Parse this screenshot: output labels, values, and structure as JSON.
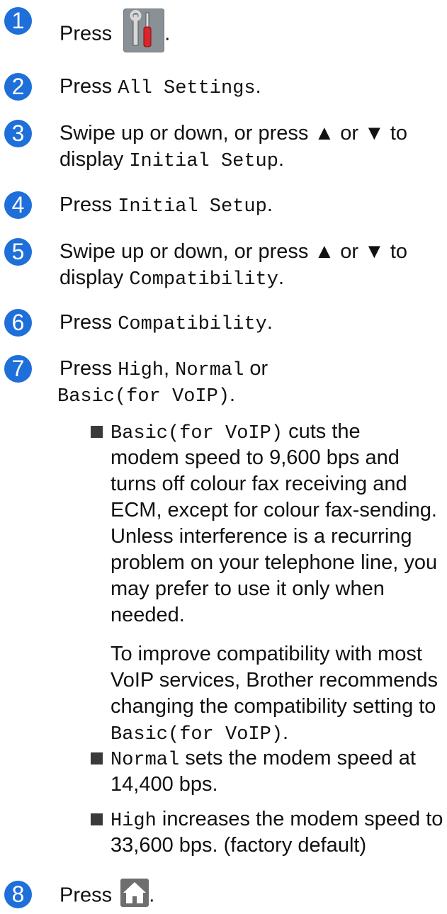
{
  "steps": [
    {
      "num": "1",
      "pre": "Press ",
      "post": "."
    },
    {
      "num": "2",
      "pre": "Press ",
      "code": "All Settings",
      "post": "."
    },
    {
      "num": "3",
      "l1": "Swipe up or down, or press ▲ or ▼ to",
      "l2pre": "display ",
      "code": "Initial Setup",
      "post": "."
    },
    {
      "num": "4",
      "pre": "Press ",
      "code": "Initial Setup",
      "post": "."
    },
    {
      "num": "5",
      "l1": "Swipe up or down, or press ▲ or ▼ to",
      "l2pre": "display ",
      "code": "Compatibility",
      "post": "."
    },
    {
      "num": "6",
      "pre": "Press ",
      "code": "Compatibility",
      "post": "."
    },
    {
      "num": "7",
      "pre": "Press ",
      "code1": "High",
      "sep": ", ",
      "code2": "Normal",
      "or": " or",
      "code3": "Basic(for VoIP)",
      "post": "."
    },
    {
      "num": "8",
      "pre": "Press ",
      "post": "."
    }
  ],
  "bullets": {
    "basic": {
      "code": "Basic(for VoIP)",
      "l1": " cuts the",
      "l2": "modem speed to 9,600 bps and",
      "l3": "turns off colour fax receiving and",
      "l4": "ECM, except for colour fax-sending.",
      "l5": "Unless interference is a recurring",
      "l6": "problem on your telephone line, you",
      "l7": "may prefer to use it only when",
      "l8": "needed."
    },
    "note": {
      "l1": "To improve compatibility with most",
      "l2": "VoIP services, Brother recommends",
      "l3": "changing the compatibility setting to",
      "code": "Basic(for VoIP)",
      "post": "."
    },
    "normal": {
      "code": "Normal",
      "l1": " sets the modem speed at",
      "l2": "14,400 bps."
    },
    "high": {
      "code": "High",
      "l1": " increases the modem speed to",
      "l2": "33,600 bps. (factory default)"
    }
  },
  "icons": {
    "settings": "settings-wrench-screwdriver-icon",
    "home": "home-icon"
  },
  "colors": {
    "step_number": "#1e6fd9",
    "settings_icon_bg": "#8a9196",
    "screwdriver_handle": "#d9262b"
  }
}
